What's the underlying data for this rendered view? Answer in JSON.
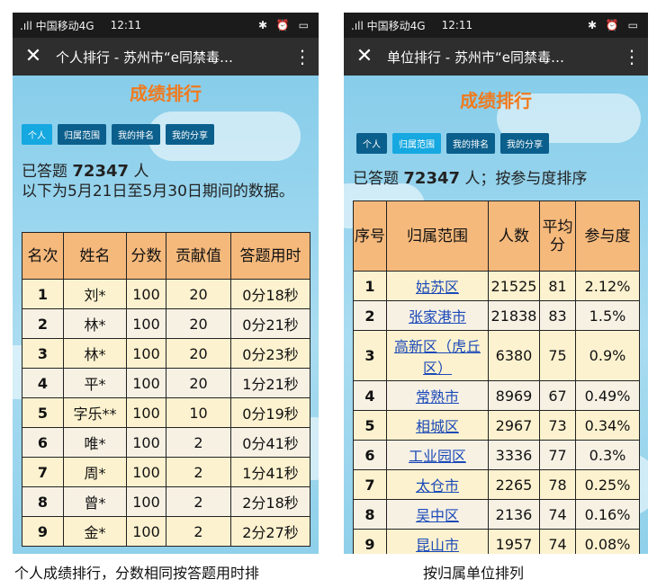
{
  "left": {
    "status": {
      "carrier": ".ıll 中国移动4G",
      "time": "12:11",
      "icons": "✱ ⏰ ▭"
    },
    "title": "个人排行 - 苏州市“e同禁毒…",
    "heading": "成绩排行",
    "tabs": [
      "个人",
      "归属范围",
      "我的排名",
      "我的分享"
    ],
    "answered_prefix": "已答题",
    "answered_count": "72347",
    "answered_suffix": "人",
    "note": "以下为5月21日至5月30日期间的数据。",
    "table": {
      "headers": [
        "名次",
        "姓名",
        "分数",
        "贡献值",
        "答题用时"
      ],
      "rows": [
        [
          "1",
          "刘*",
          "100",
          "20",
          "0分18秒"
        ],
        [
          "2",
          "林*",
          "100",
          "20",
          "0分21秒"
        ],
        [
          "3",
          "林*",
          "100",
          "20",
          "0分23秒"
        ],
        [
          "4",
          "平*",
          "100",
          "20",
          "1分21秒"
        ],
        [
          "5",
          "字乐**",
          "100",
          "10",
          "0分19秒"
        ],
        [
          "6",
          "唯*",
          "100",
          "2",
          "0分41秒"
        ],
        [
          "7",
          "周*",
          "100",
          "2",
          "1分41秒"
        ],
        [
          "8",
          "曾*",
          "100",
          "2",
          "2分18秒"
        ],
        [
          "9",
          "金*",
          "100",
          "2",
          "2分27秒"
        ]
      ]
    },
    "caption": "个人成绩排行，分数相同按答题用时排"
  },
  "right": {
    "status": {
      "carrier": ".ıll 中国移动4G",
      "time": "12:11",
      "icons": "✱ ⏰ ▭"
    },
    "title": "单位排行 - 苏州市“e同禁毒…",
    "heading": "成绩排行",
    "tabs": [
      "个人",
      "归属范围",
      "我的排名",
      "我的分享"
    ],
    "answered_prefix": "已答题",
    "answered_count": "72347",
    "answered_suffix": "人；按参与度排序",
    "table": {
      "headers": [
        "序号",
        "归属范围",
        "人数",
        "平均分",
        "参与度"
      ],
      "rows": [
        [
          "1",
          "姑苏区",
          "21525",
          "81",
          "2.12%"
        ],
        [
          "2",
          "张家港市",
          "21838",
          "83",
          "1.5%"
        ],
        [
          "3",
          "高新区（虎丘区）",
          "6380",
          "75",
          "0.9%"
        ],
        [
          "4",
          "常熟市",
          "8969",
          "67",
          "0.49%"
        ],
        [
          "5",
          "相城区",
          "2967",
          "73",
          "0.34%"
        ],
        [
          "6",
          "工业园区",
          "3336",
          "77",
          "0.3%"
        ],
        [
          "7",
          "太仓市",
          "2265",
          "78",
          "0.25%"
        ],
        [
          "8",
          "吴中区",
          "2136",
          "74",
          "0.16%"
        ],
        [
          "9",
          "昆山市",
          "1957",
          "74",
          "0.08%"
        ]
      ]
    },
    "caption": "按归属单位排列"
  }
}
